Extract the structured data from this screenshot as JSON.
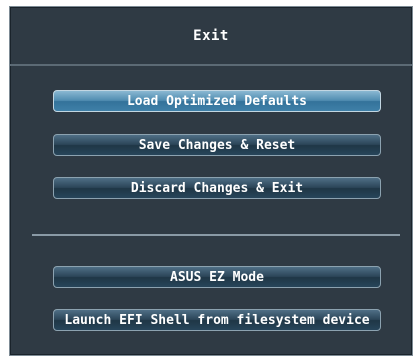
{
  "dialog": {
    "title": "Exit",
    "primary_options": [
      {
        "label": "Load Optimized Defaults",
        "highlighted": true
      },
      {
        "label": "Save Changes & Reset",
        "highlighted": false
      },
      {
        "label": "Discard Changes & Exit",
        "highlighted": false
      }
    ],
    "secondary_options": [
      {
        "label": "ASUS EZ Mode",
        "highlighted": false
      },
      {
        "label": "Launch EFI Shell from filesystem device",
        "highlighted": false
      }
    ]
  },
  "colors": {
    "panel_background": "#2f3a44",
    "button_normal": "#2b4558",
    "button_highlighted": "#4f8cb0",
    "text": "#ffffff"
  }
}
